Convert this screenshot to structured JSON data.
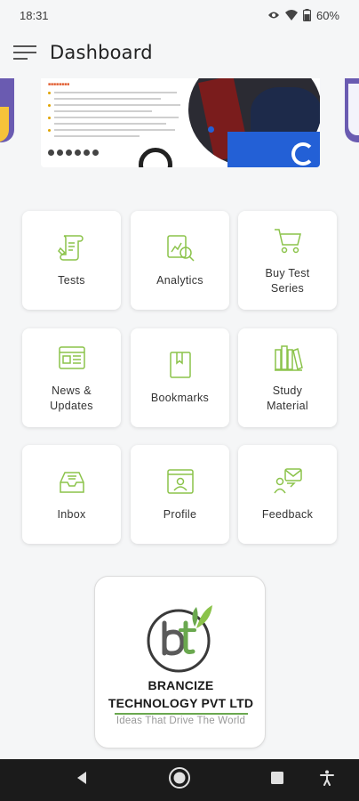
{
  "status_bar": {
    "time": "18:31",
    "battery": "60%",
    "icons": [
      "eye-icon",
      "wifi-icon",
      "battery-icon"
    ]
  },
  "app_bar": {
    "title": "Dashboard",
    "menu_icon": "hamburger-menu-icon"
  },
  "colors": {
    "icon_green": "#8bc34a",
    "accent_blue": "#2360d6",
    "banner_purple": "#6a5bb1",
    "banner_yellow": "#f6c33a",
    "background": "#f5f6f7",
    "logo_green": "#6aa84f"
  },
  "tiles": [
    {
      "label": "Tests",
      "icon": "test-scroll-icon"
    },
    {
      "label": "Analytics",
      "icon": "analytics-search-icon"
    },
    {
      "label": "Buy Test\nSeries",
      "icon": "shopping-cart-icon"
    },
    {
      "label": "News &\nUpdates",
      "icon": "newspaper-icon"
    },
    {
      "label": "Bookmarks",
      "icon": "bookmark-icon"
    },
    {
      "label": "Study\nMaterial",
      "icon": "books-icon"
    },
    {
      "label": "Inbox",
      "icon": "inbox-icon"
    },
    {
      "label": "Profile",
      "icon": "profile-icon"
    },
    {
      "label": "Feedback",
      "icon": "feedback-icon"
    }
  ],
  "company": {
    "name_line1": "BRANCIZE",
    "name_line2": "TECHNOLOGY PVT LTD",
    "tagline": "Ideas That Drive The World"
  },
  "nav_bar": {
    "buttons": [
      "back-icon",
      "home-icon",
      "recents-icon",
      "accessibility-icon"
    ]
  }
}
